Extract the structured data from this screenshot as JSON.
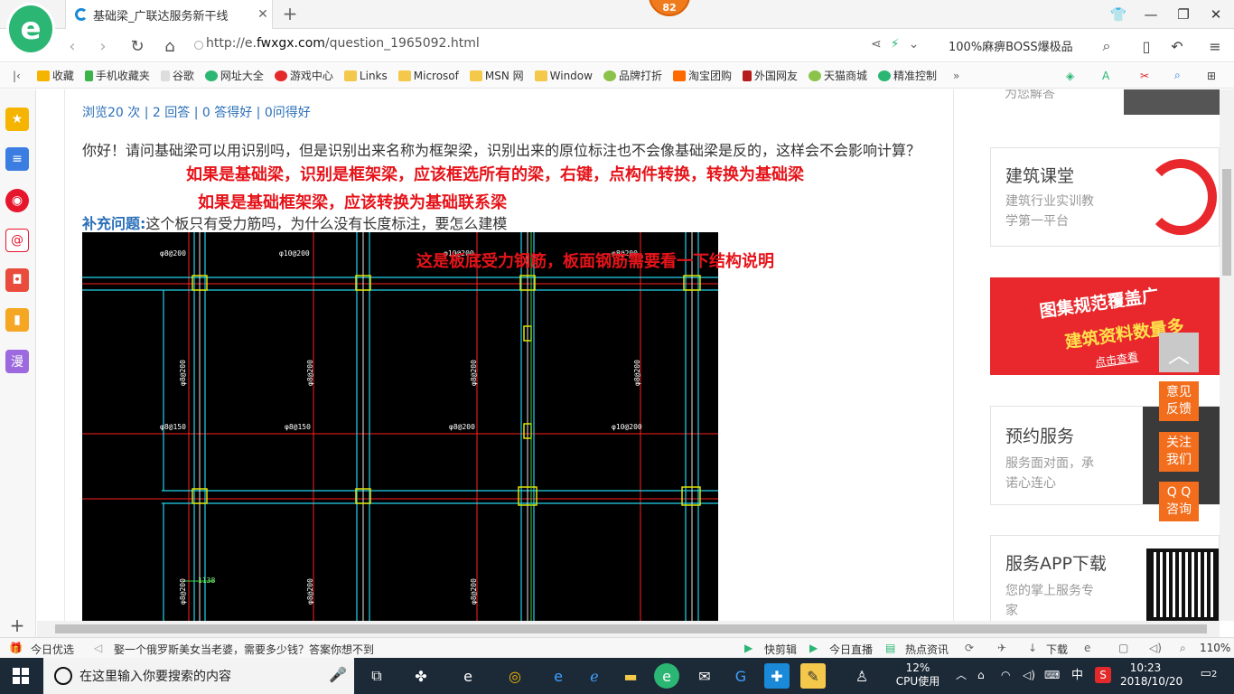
{
  "browser": {
    "logo_letter": "e",
    "tab_title": "基础梁_广联达服务新干线",
    "badge": "82",
    "url_prefix": "http://e.",
    "url_domain": "fwxgx.com",
    "url_path": "/question_1965092.html",
    "search_text": "100%麻痹BOSS爆极品"
  },
  "bookmarks": [
    "收藏",
    "手机收藏夹",
    "谷歌",
    "网址大全",
    "游戏中心",
    "Links",
    "Microsof",
    "MSN 网",
    "Window",
    "品牌打折",
    "淘宝团购",
    "外国网友",
    "天猫商城",
    "精准控制"
  ],
  "page": {
    "stats": "浏览20 次 | 2 回答 | 0 答得好 | 0问得好",
    "question": "你好！请问基础梁可以用识别吗，但是识别出来名称为框架梁，识别出来的原位标注也不会像基础梁是反的，这样会不会影响计算？",
    "annotation1": "如果是基础梁，识别是框架梁，应该框选所有的梁，右键，点构件转换，转换为基础梁",
    "annotation2": "如果是基础框架梁，应该转换为基础联系梁",
    "supplement_label": "补充问题:",
    "supplement_text": "这个板只有受力筋吗，为什么没有长度标注，要怎么建模",
    "annotation3": "这是板底受力钢筋，板面钢筋需要看一下结构说明"
  },
  "cad_labels": [
    "φ8@200",
    "φ10@200",
    "φ10@200",
    "φ8@200",
    "φ8@200",
    "φ8@200",
    "φ8@200",
    "φ8@150",
    "φ8@200",
    "φ8@150",
    "φ10@200",
    "φ8@200",
    "φ8@200",
    "φ8@200",
    "φ8@200",
    "1138"
  ],
  "sidebar_right": {
    "top_text": "为您解答",
    "card1_title": "建筑课堂",
    "card1_sub1": "建筑行业实训教",
    "card1_sub2": "学第一平台",
    "promo_line1": "图集规范覆盖广",
    "promo_line2": "建筑资料数量多",
    "promo_cta": "点击查看",
    "card2_title": "预约服务",
    "card2_sub1": "服务面对面，承",
    "card2_sub2": "诺心连心",
    "card3_title": "服务APP下载",
    "card3_sub1": "您的掌上服务专",
    "card3_sub2": "家"
  },
  "float_buttons": [
    [
      "意见",
      "反馈"
    ],
    [
      "关注",
      "我们"
    ],
    [
      "Q Q",
      "咨询"
    ]
  ],
  "statusbar": {
    "left1": "今日优选",
    "news": "娶一个俄罗斯美女当老婆，需要多少钱？答案你想不到",
    "quick_cut": "快剪辑",
    "live": "今日直播",
    "hot": "热点资讯",
    "download": "下载",
    "zoom": "110%"
  },
  "taskbar": {
    "search_placeholder": "在这里输入你要搜索的内容",
    "cpu_pct": "12%",
    "cpu_label": "CPU使用",
    "ime": "中",
    "time": "10:23",
    "date": "2018/10/20",
    "notif_count": "2"
  },
  "colors": {
    "accent_blue": "#2a6fb8",
    "annotation_red": "#e5141a",
    "float_orange": "#f26d1c",
    "taskbar": "#1c2a38"
  }
}
